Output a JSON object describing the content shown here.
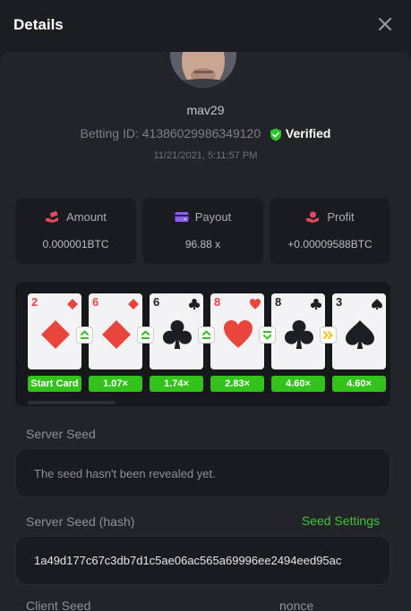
{
  "header": {
    "title": "Details",
    "close_icon": "close-icon"
  },
  "profile": {
    "username": "mav29",
    "betting_id_label": "Betting ID:",
    "betting_id": "41386029986349120",
    "verified_label": "Verified",
    "datetime": "11/21/2021, 5:11:57 PM"
  },
  "stats": [
    {
      "label": "Amount",
      "value": "0.000001BTC",
      "icon": "money-hand-icon",
      "color": "#e24a5b"
    },
    {
      "label": "Payout",
      "value": "96.88 x",
      "icon": "wallet-icon",
      "color": "#8b5cf6"
    },
    {
      "label": "Profit",
      "value": "+0.00009588BTC",
      "icon": "profit-hand-icon",
      "color": "#e24a5b"
    }
  ],
  "cards": [
    {
      "rank": "2",
      "suit": "diamond",
      "color": "#e8453c",
      "multiplier": "Start Card"
    },
    {
      "rank": "6",
      "suit": "diamond",
      "color": "#e8453c",
      "multiplier": "1.07×",
      "guess": "higher"
    },
    {
      "rank": "6",
      "suit": "club",
      "color": "#1d1e22",
      "multiplier": "1.74×",
      "guess": "higher"
    },
    {
      "rank": "8",
      "suit": "heart",
      "color": "#e8453c",
      "multiplier": "2.83×",
      "guess": "higher"
    },
    {
      "rank": "8",
      "suit": "club",
      "color": "#1d1e22",
      "multiplier": "4.60×",
      "guess": "lower"
    },
    {
      "rank": "3",
      "suit": "spade",
      "color": "#1d1e22",
      "multiplier": "4.60×",
      "guess": "skip"
    }
  ],
  "server_seed": {
    "label": "Server Seed",
    "value": "The seed hasn't been revealed yet."
  },
  "server_seed_hash": {
    "label": "Server Seed (hash)",
    "settings_link": "Seed Settings",
    "value": "1a49d177c67c3db7d1c5ae06ac565a69996ee2494eed95ac"
  },
  "client_seed": {
    "label": "Client Seed",
    "nonce_label": "nonce"
  },
  "colors": {
    "accent_green": "#3fc43f",
    "multiplier_green": "#33c21c",
    "background": "#1c1d21"
  }
}
